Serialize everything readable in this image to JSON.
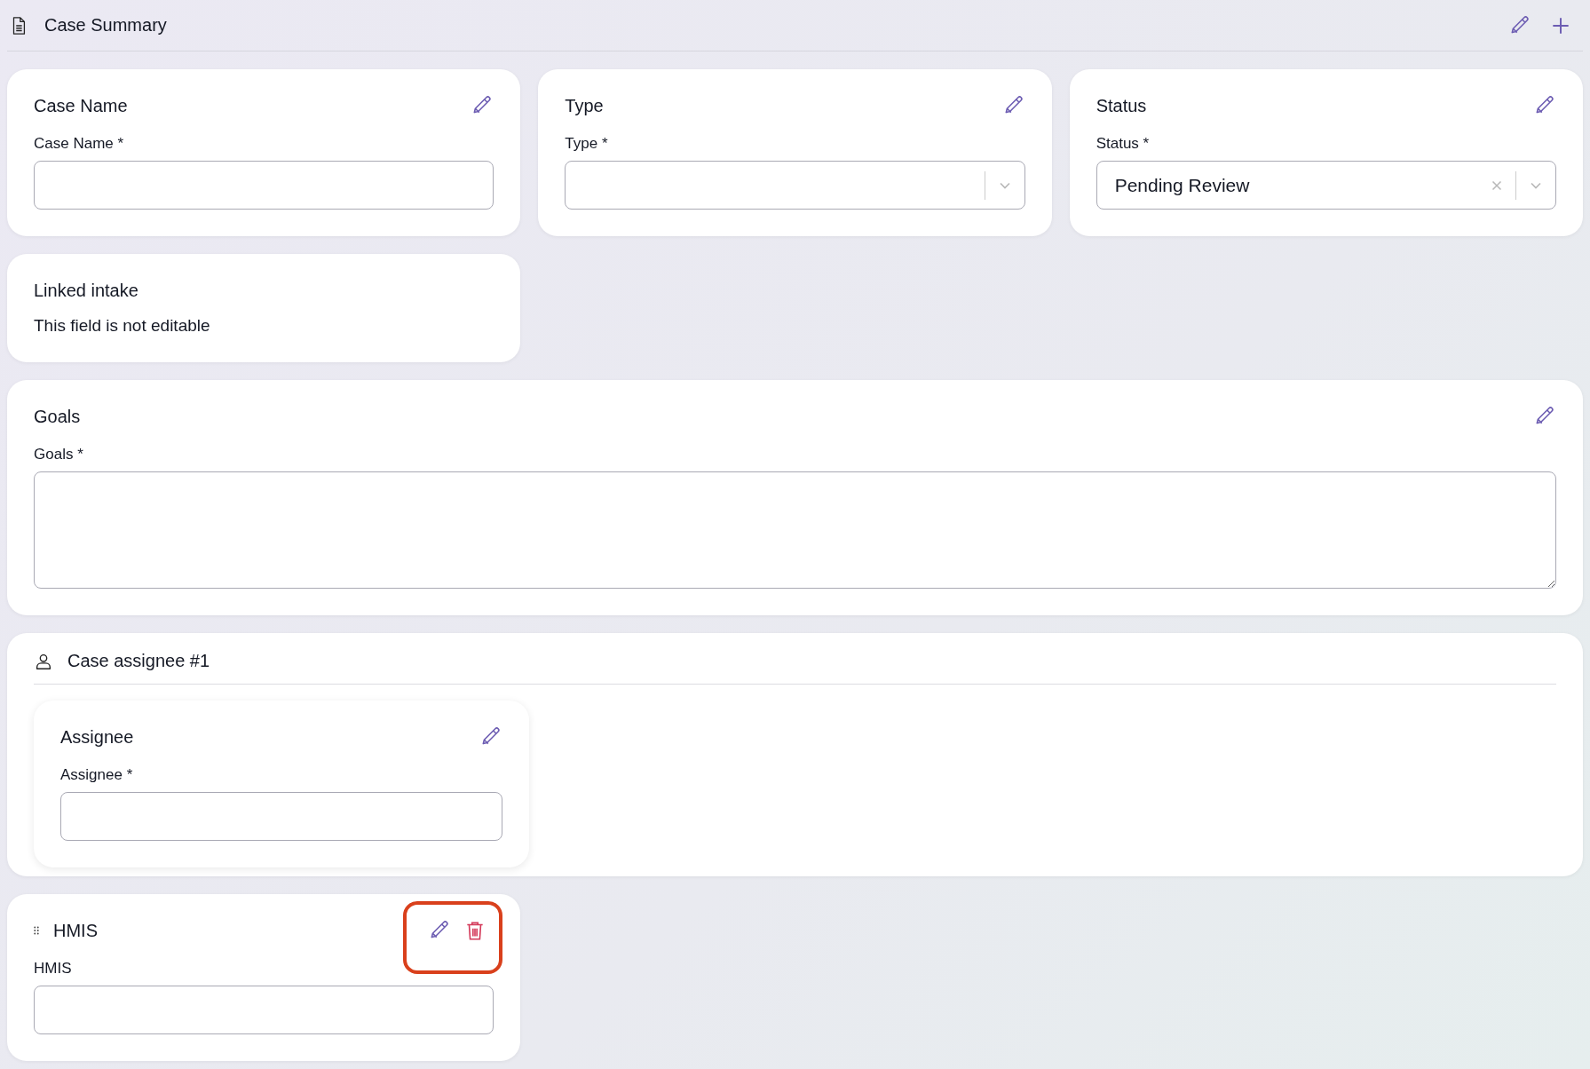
{
  "header": {
    "title": "Case Summary"
  },
  "cards": [
    {
      "kind": "field",
      "title": "Case Name",
      "label": "Case Name *",
      "field": {
        "kind": "text"
      }
    },
    {
      "kind": "field",
      "title": "Type",
      "label": "Type *",
      "field": {
        "kind": "select"
      }
    },
    {
      "kind": "field",
      "title": "Status",
      "label": "Status *",
      "field": {
        "kind": "select",
        "value": "Pending Review"
      }
    },
    {
      "kind": "readonly",
      "title": "Linked intake",
      "note": "This field is not editable"
    },
    {
      "kind": "field",
      "title": "Goals",
      "label": "Goals *",
      "field": {
        "kind": "textarea"
      }
    },
    {
      "kind": "section",
      "title": "Case assignee #1",
      "cards": [
        {
          "kind": "field",
          "title": "Assignee",
          "label": "Assignee *",
          "field": {
            "kind": "text"
          }
        }
      ]
    },
    {
      "kind": "field",
      "title": "HMIS",
      "label": "HMIS",
      "draggable": true,
      "deletable": true,
      "highlighted": true,
      "field": {
        "kind": "text"
      }
    }
  ]
}
